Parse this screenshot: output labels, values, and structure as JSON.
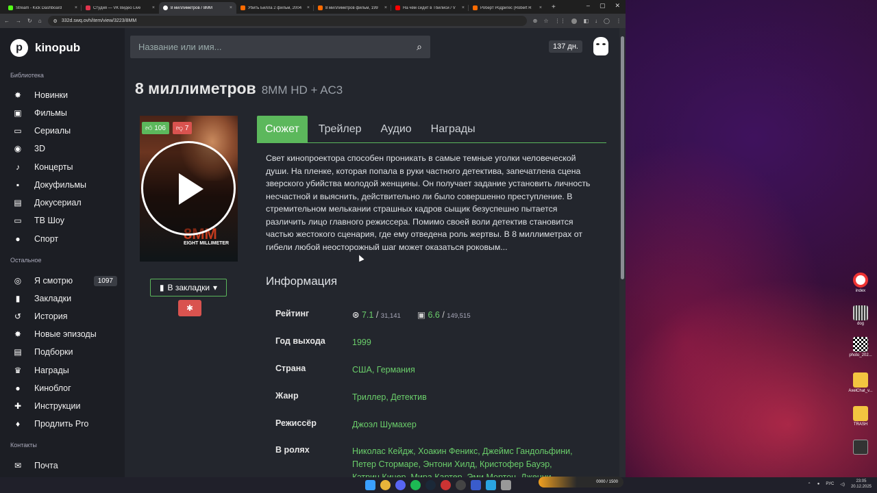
{
  "browser": {
    "tabs": [
      {
        "label": "Stream - Kick Dashboard",
        "color": "#53fc18",
        "active": false
      },
      {
        "label": "Студия — VK Видео Live",
        "color": "#e0344d",
        "active": false
      },
      {
        "label": "8 миллиметров / 8MM",
        "color": "#ffffff",
        "active": true
      },
      {
        "label": "Убить Билла 2 фильм, 2004",
        "color": "#ff6b00",
        "active": false
      },
      {
        "label": "8 миллиметров фильм, 199",
        "color": "#ff6b00",
        "active": false
      },
      {
        "label": "На чём сидит в Тбилиси / V",
        "color": "#ff0000",
        "active": false
      },
      {
        "label": "Роберт Родригес (Robert R",
        "color": "#ff6b00",
        "active": false
      }
    ],
    "url": "332d.swq.ovh/item/view/3223/8MM"
  },
  "sidebar": {
    "logo": "kinopub",
    "section_library": "Библиотека",
    "section_other": "Остальное",
    "section_contacts": "Контакты",
    "items": [
      {
        "label": "Новинки",
        "icon": "✸"
      },
      {
        "label": "Фильмы",
        "icon": "▣"
      },
      {
        "label": "Сериалы",
        "icon": "▭"
      },
      {
        "label": "3D",
        "icon": "◉"
      },
      {
        "label": "Концерты",
        "icon": "♪"
      },
      {
        "label": "Докуфильмы",
        "icon": "▪"
      },
      {
        "label": "Докусериал",
        "icon": "▤"
      },
      {
        "label": "ТВ Шоу",
        "icon": "▭"
      },
      {
        "label": "Спорт",
        "icon": "●"
      }
    ],
    "other": [
      {
        "label": "Я смотрю",
        "icon": "◎",
        "badge": "1097"
      },
      {
        "label": "Закладки",
        "icon": "▮"
      },
      {
        "label": "История",
        "icon": "↺"
      },
      {
        "label": "Новые эпизоды",
        "icon": "✸"
      },
      {
        "label": "Подборки",
        "icon": "▤"
      },
      {
        "label": "Награды",
        "icon": "♛"
      },
      {
        "label": "Киноблог",
        "icon": "●"
      },
      {
        "label": "Инструкции",
        "icon": "✚"
      },
      {
        "label": "Продлить Pro",
        "icon": "♦"
      }
    ],
    "contacts": [
      {
        "label": "Почта",
        "icon": "✉"
      }
    ]
  },
  "header": {
    "search_placeholder": "Название или имя...",
    "days": "137 дн."
  },
  "movie": {
    "title": "8 миллиметров",
    "subtitle": "8MM HD + AC3",
    "likes": "106",
    "dislikes": "7",
    "poster_title": "8MM",
    "poster_subtitle": "EIGHT MILLIMETER",
    "bookmark_label": "В закладки",
    "tabs": [
      "Сюжет",
      "Трейлер",
      "Аудио",
      "Награды"
    ],
    "plot": "Свет кинопроектора способен проникать в самые темные уголки человеческой души. На пленке, которая попала в руки частного детектива, запечатлена сцена зверского убийства молодой женщины. Он получает задание установить личность несчастной и выяснить, действительно ли было совершенно преступление. В стремительном мелькании страшных кадров сыщик безуспешно пытается различить лицо главного режиссера. Помимо своей воли детектив становится частью жестокого сценария, где ему отведена роль жертвы. В 8 миллиметрах от гибели любой неосторожный шаг может оказаться роковым...",
    "info_title": "Информация",
    "rating_label": "Рейтинг",
    "rating_kp": "7.1",
    "rating_kp_votes": "31,141",
    "rating_imdb": "6.6",
    "rating_imdb_votes": "149,515",
    "year_label": "Год выхода",
    "year": "1999",
    "country_label": "Страна",
    "country": "США, Германия",
    "genre_label": "Жанр",
    "genre": "Триллер, Детектив",
    "director_label": "Режиссёр",
    "director": "Джоэл Шумахер",
    "cast_label": "В ролях",
    "cast": "Николас Кейдж, Хоакин Феникс, Джеймс Гандольфини, Петер Стормаре, Энтони Хилд, Кристофер Бауэр, Кэтрин Кинер, Мира Картер, Эми Мортон, Дженни Пауэлл, Энтони"
  },
  "desktop": {
    "icons": [
      "index",
      "dog",
      "photo_202...",
      "AxelChat_v...",
      "TRASH",
      ""
    ]
  },
  "taskbar": {
    "lang": "РУС",
    "time": "23:05",
    "date": "20.12.2025",
    "overlay": "0000 / 1500"
  }
}
